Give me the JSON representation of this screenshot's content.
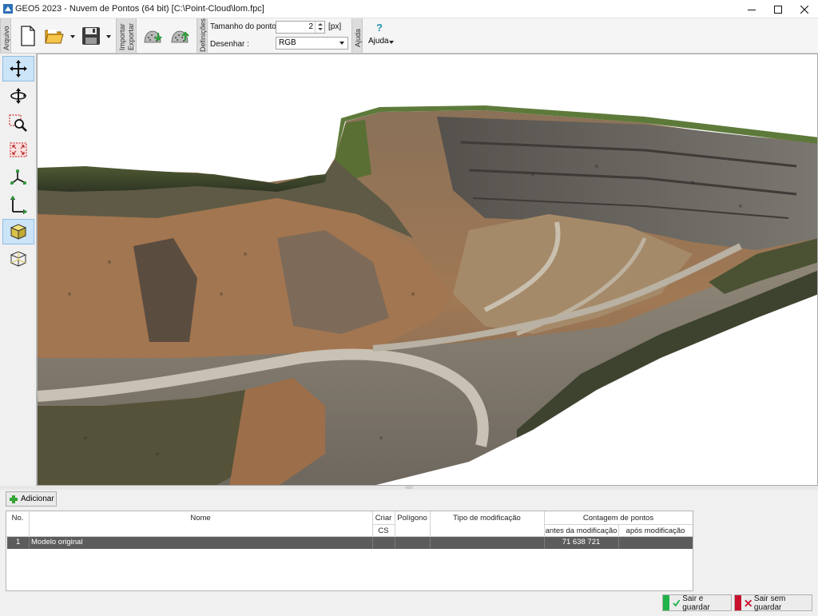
{
  "window": {
    "title": "GEO5 2023 - Nuvem de Pontos (64 bit) [C:\\Point-Cloud\\lom.fpc]"
  },
  "toolbar": {
    "tab_file": "Arquivo",
    "tab_import_1": "Importar",
    "tab_import_2": "Exportar",
    "tab_settings": "Definições",
    "tab_help": "Ajuda",
    "point_size_label": "Tamanho do ponto :",
    "point_size_value": "2",
    "point_size_unit": "[px]",
    "draw_label": "Desenhar :",
    "draw_value": "RGB",
    "help_label": "Ajuda",
    "help_symbol": "?"
  },
  "left_tools": [
    {
      "icon": "move-icon",
      "active": true
    },
    {
      "icon": "rotate-icon",
      "active": false
    },
    {
      "icon": "zoom-window-icon",
      "active": false
    },
    {
      "icon": "zoom-extents-icon",
      "active": false
    },
    {
      "icon": "axes-3d-icon",
      "active": false
    },
    {
      "icon": "axes-2d-icon",
      "active": false
    },
    {
      "icon": "solid-box-icon",
      "active": true
    },
    {
      "icon": "wire-box-icon",
      "active": false
    }
  ],
  "bottom": {
    "add_label": "Adicionar",
    "headers": {
      "no": "No.",
      "name": "Nome",
      "create_1": "Criar",
      "create_2": "CS",
      "polygon": "Polígono",
      "mod_type": "Tipo de modificação",
      "count": "Contagem de pontos",
      "before": "antes da modificação",
      "after": "após modificação"
    },
    "rows": [
      {
        "no": "1",
        "name": "Modelo original",
        "create_cs": "",
        "polygon": "",
        "mod_type": "",
        "before": "71 638 721",
        "after": ""
      }
    ],
    "save_exit": "Sair e guardar",
    "exit_no_save": "Sair sem guardar"
  },
  "colors": {
    "accent_green": "#1fb34a",
    "accent_red": "#c8102e",
    "selection_row": "#5c5c5c",
    "tool_active": "#cce4f7"
  }
}
